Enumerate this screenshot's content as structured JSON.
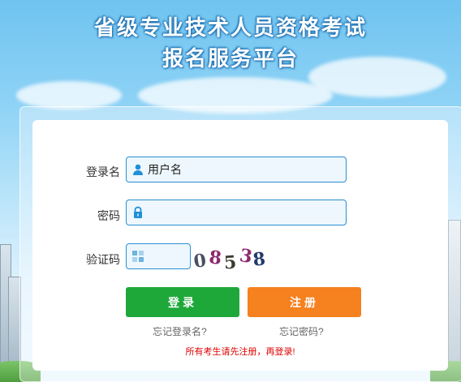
{
  "header": {
    "title_line1": "省级专业技术人员资格考试",
    "title_line2": "报名服务平台"
  },
  "form": {
    "username_label": "登录名",
    "username_placeholder": "用户名",
    "password_label": "密码",
    "password_placeholder": "",
    "captcha_label": "验证码",
    "captcha_placeholder": "",
    "captcha_chars": [
      {
        "ch": "0",
        "color": "#4a5060"
      },
      {
        "ch": "8",
        "color": "#8b2a6d"
      },
      {
        "ch": "5",
        "color": "#3b3b2e"
      },
      {
        "ch": "3",
        "color": "#8b2a6d"
      },
      {
        "ch": "8",
        "color": "#1f3a6b"
      }
    ]
  },
  "buttons": {
    "login_label": "登录",
    "register_label": "注册"
  },
  "links": {
    "forgot_username": "忘记登录名?",
    "forgot_password": "忘记密码?"
  },
  "notice": "所有考生请先注册，再登录!",
  "colors": {
    "login_button": "#1fa83a",
    "register_button": "#f5811f",
    "field_border": "#2a8fd0",
    "notice_text": "#e00000"
  },
  "icons": {
    "username": "user-icon",
    "password": "lock-icon",
    "captcha": "captcha-icon"
  }
}
